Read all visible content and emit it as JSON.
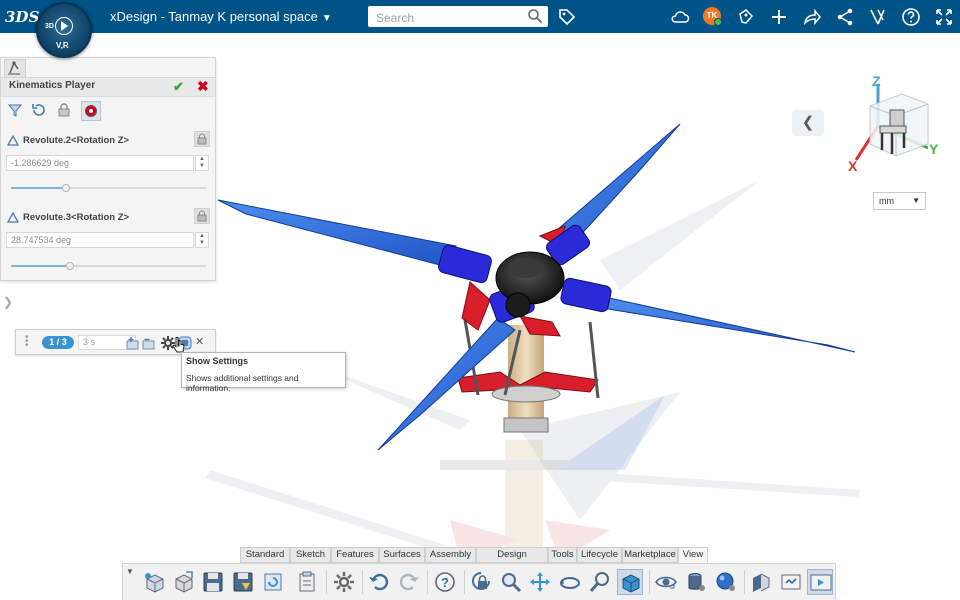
{
  "header": {
    "brand_logo": "3DS",
    "compass": {
      "q1": "3D",
      "q2": "V,R"
    },
    "title": "xDesign - Tanmay K personal space",
    "search_placeholder": "Search",
    "avatar_initials": "TK"
  },
  "kinematics_panel": {
    "title": "Kinematics Player",
    "joints": [
      {
        "label": "Revolute.2<Rotation Z>",
        "value": "-1.286629 deg",
        "slider": 0.28
      },
      {
        "label": "Revolute.3<Rotation Z>",
        "value": "28.747534 deg",
        "slider": 0.3
      }
    ]
  },
  "player": {
    "counter": "1 / 3",
    "duration_placeholder": "3 s"
  },
  "tooltip": {
    "title": "Show Settings",
    "description": "Shows additional settings and information."
  },
  "navcube": {
    "x": "X",
    "y": "Y",
    "z": "Z"
  },
  "unit_select": "mm",
  "action_tabs": [
    "Standard",
    "Sketch",
    "Features",
    "Surfaces",
    "Assembly",
    "Design Guidance",
    "Tools",
    "Lifecycle",
    "Marketplace",
    "View"
  ],
  "active_tab": "View",
  "colors": {
    "topbar": "#005386",
    "blade_blue": "#2f6fe0",
    "hub_blue": "#2a2ad8",
    "link_red": "#d81e2a",
    "accent_blue": "#3a93d1"
  }
}
